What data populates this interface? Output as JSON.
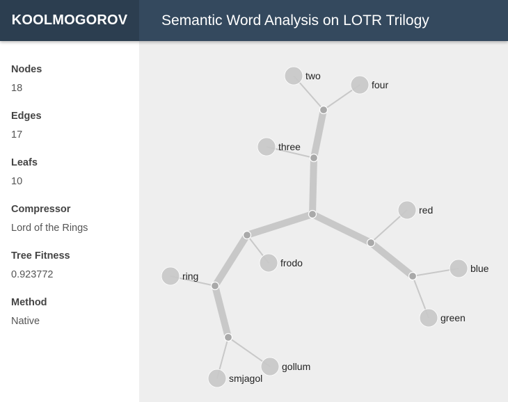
{
  "header": {
    "brand": "KOOLMOGOROV",
    "title": "Semantic Word Analysis on LOTR Trilogy"
  },
  "sidebar": {
    "stats": [
      {
        "label": "Nodes",
        "value": "18"
      },
      {
        "label": "Edges",
        "value": "17"
      },
      {
        "label": "Leafs",
        "value": "10"
      },
      {
        "label": "Compressor",
        "value": "Lord of the Rings"
      },
      {
        "label": "Tree Fitness",
        "value": "0.923772"
      },
      {
        "label": "Method",
        "value": "Native"
      }
    ]
  },
  "tree": {
    "colors": {
      "edge": "#c8c8c8",
      "leaf": "#c8c8c8",
      "internal": "#a9a9a9",
      "internal_stroke": "#ffffff",
      "label": "#222222"
    },
    "nodes": [
      {
        "id": "root",
        "type": "internal"
      },
      {
        "id": "n1",
        "type": "internal"
      },
      {
        "id": "n2",
        "type": "internal"
      },
      {
        "id": "n3",
        "type": "internal"
      },
      {
        "id": "n4",
        "type": "internal"
      },
      {
        "id": "n5",
        "type": "internal"
      },
      {
        "id": "n6",
        "type": "internal"
      },
      {
        "id": "n7",
        "type": "internal"
      },
      {
        "id": "two",
        "type": "leaf",
        "label": "two"
      },
      {
        "id": "four",
        "type": "leaf",
        "label": "four"
      },
      {
        "id": "three",
        "type": "leaf",
        "label": "three"
      },
      {
        "id": "red",
        "type": "leaf",
        "label": "red"
      },
      {
        "id": "blue",
        "type": "leaf",
        "label": "blue"
      },
      {
        "id": "green",
        "type": "leaf",
        "label": "green"
      },
      {
        "id": "frodo",
        "type": "leaf",
        "label": "frodo"
      },
      {
        "id": "ring",
        "type": "leaf",
        "label": "ring"
      },
      {
        "id": "gollum",
        "type": "leaf",
        "label": "gollum"
      },
      {
        "id": "smjagol",
        "type": "leaf",
        "label": "smjagol"
      }
    ],
    "edges": [
      {
        "from": "root",
        "to": "n1",
        "weight": "thick"
      },
      {
        "from": "n1",
        "to": "three",
        "weight": "thin"
      },
      {
        "from": "n1",
        "to": "n2",
        "weight": "thick"
      },
      {
        "from": "n2",
        "to": "two",
        "weight": "thin"
      },
      {
        "from": "n2",
        "to": "four",
        "weight": "thin"
      },
      {
        "from": "root",
        "to": "n3",
        "weight": "thick"
      },
      {
        "from": "n3",
        "to": "red",
        "weight": "thin"
      },
      {
        "from": "n3",
        "to": "n4",
        "weight": "thick"
      },
      {
        "from": "n4",
        "to": "blue",
        "weight": "thin"
      },
      {
        "from": "n4",
        "to": "green",
        "weight": "thin"
      },
      {
        "from": "root",
        "to": "n5",
        "weight": "thick"
      },
      {
        "from": "n5",
        "to": "frodo",
        "weight": "thin"
      },
      {
        "from": "n5",
        "to": "n6",
        "weight": "thick"
      },
      {
        "from": "n6",
        "to": "ring",
        "weight": "thin"
      },
      {
        "from": "n6",
        "to": "n7",
        "weight": "thick"
      },
      {
        "from": "n7",
        "to": "gollum",
        "weight": "thin"
      },
      {
        "from": "n7",
        "to": "smjagol",
        "weight": "thin"
      }
    ]
  }
}
